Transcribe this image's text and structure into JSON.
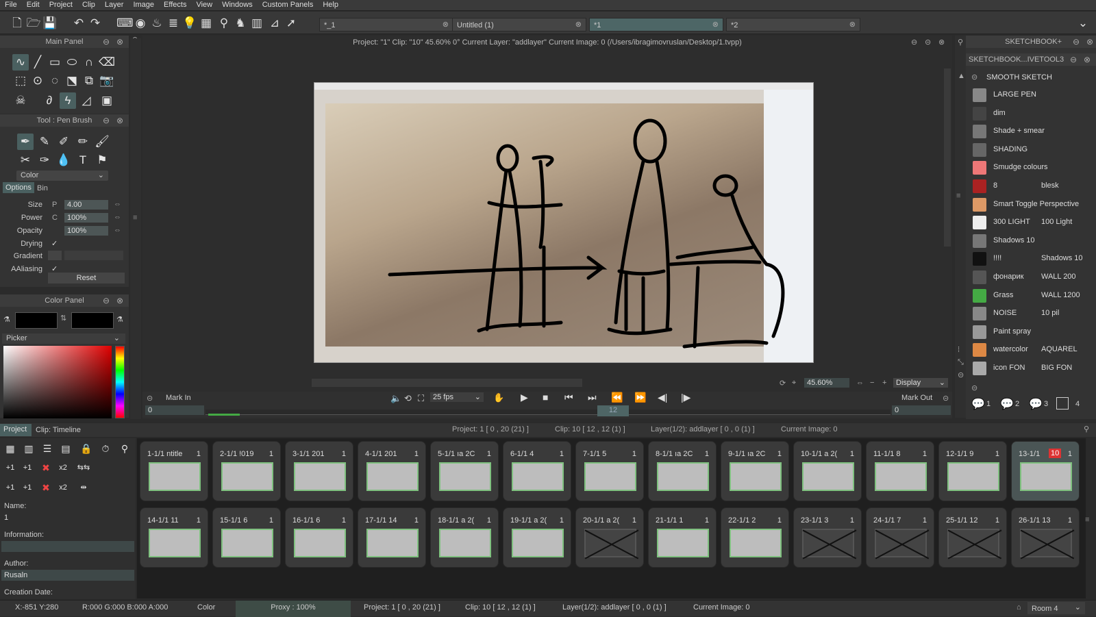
{
  "menu": [
    "File",
    "Edit",
    "Project",
    "Clip",
    "Layer",
    "Image",
    "Effects",
    "View",
    "Windows",
    "Custom Panels",
    "Help"
  ],
  "doc_tabs": [
    {
      "label": "*_1",
      "active": false
    },
    {
      "label": "Untitled (1)",
      "active": false
    },
    {
      "label": "*1",
      "active": true
    },
    {
      "label": "*2",
      "active": false
    }
  ],
  "main_panel": {
    "title": "Main Panel"
  },
  "tool_panel": {
    "title": "Tool : Pen Brush",
    "color_select": "Color",
    "tabs": [
      "Options",
      "Bin"
    ]
  },
  "props": {
    "size_label": "Size",
    "size_mode": "P",
    "size_value": "4.00",
    "power_label": "Power",
    "power_mode": "C",
    "power_value": "100%",
    "opacity_label": "Opacity",
    "opacity_value": "100%",
    "drying_label": "Drying",
    "drying_check": "✓",
    "gradient_label": "Gradient",
    "aaliasing_label": "AAliasing",
    "aaliasing_check": "✓",
    "reset_label": "Reset"
  },
  "color_panel": {
    "title": "Color Panel",
    "picker_label": "Picker"
  },
  "canvas": {
    "info": "Project: \"1\"  Clip: \"10\"   45.60%   0°  Current Layer: \"addlayer\"  Current Image: 0 (/Users/ibragimovruslan/Desktop/1.tvpp)",
    "zoom": "45.60%",
    "display": "Display",
    "fps": "25 fps",
    "mark_in": "Mark In",
    "mark_out": "Mark Out",
    "frame_start": "0",
    "frame_end": "0",
    "frame_marker": "12"
  },
  "sketchbook": {
    "title": "SKETCHBOOK+",
    "subtitle": "SKETCHBOOK...IVETOOL3",
    "section": "SMOOTH SKETCH",
    "rows": [
      {
        "labels": [
          "LARGE PEN"
        ]
      },
      {
        "labels": [
          "dim"
        ]
      },
      {
        "labels": [
          "Shade + smear"
        ]
      },
      {
        "labels": [
          "SHADING"
        ]
      },
      {
        "labels": [
          "Smudge colours"
        ]
      },
      {
        "labels": [
          "8",
          "blesk"
        ]
      },
      {
        "labels": [
          "Smart Toggle Perspective"
        ]
      },
      {
        "labels": [
          "300 LIGHT",
          "100 Light"
        ]
      },
      {
        "labels": [
          "Shadows 10"
        ]
      },
      {
        "labels": [
          "!!!!",
          "Shadows 10"
        ]
      },
      {
        "labels": [
          "фонарик",
          "WALL 200"
        ]
      },
      {
        "labels": [
          "Grass",
          "WALL 1200"
        ]
      },
      {
        "labels": [
          "NOISE",
          "10 pil"
        ]
      },
      {
        "labels": [
          "Paint spray"
        ]
      },
      {
        "labels": [
          "watercolor",
          "AQUAREL"
        ]
      },
      {
        "labels": [
          "icon FON",
          "BIG FON"
        ]
      }
    ],
    "bottom_nums": [
      "1",
      "2",
      "3",
      "4"
    ]
  },
  "project_panel": {
    "tabs": [
      "Project",
      "Clip: Timeline"
    ],
    "status": [
      "Project: 1 [ 0 , 20  (21) ]",
      "Clip: 10 [ 12 , 12  (1) ]",
      "Layer(1/2): addlayer [ 0 , 0  (1) ]",
      "Current Image: 0"
    ],
    "name_label": "Name:",
    "name_value": "1",
    "info_label": "Information:",
    "author_label": "Author:",
    "author_value": "Rusaln",
    "created_label": "Creation Date:"
  },
  "thumbs": [
    {
      "label": "1-1/1  ntitle",
      "num": "1",
      "crossed": false
    },
    {
      "label": "2-1/1  !019",
      "num": "1",
      "crossed": false
    },
    {
      "label": "3-1/1  201",
      "num": "1",
      "crossed": false
    },
    {
      "label": "4-1/1  201",
      "num": "1",
      "crossed": false
    },
    {
      "label": "5-1/1  ıa 2C",
      "num": "1",
      "crossed": false
    },
    {
      "label": "6-1/1   4",
      "num": "1",
      "crossed": false
    },
    {
      "label": "7-1/1   5",
      "num": "1",
      "crossed": false
    },
    {
      "label": "8-1/1  ıa 2C",
      "num": "1",
      "crossed": false
    },
    {
      "label": "9-1/1  ıa 2C",
      "num": "1",
      "crossed": false
    },
    {
      "label": "10-1/1  a 2(",
      "num": "1",
      "crossed": false
    },
    {
      "label": "11-1/1   8",
      "num": "1",
      "crossed": false
    },
    {
      "label": "12-1/1   9",
      "num": "1",
      "crossed": false
    },
    {
      "label": "13-1/1",
      "num": "1",
      "badge": "10",
      "crossed": false
    },
    {
      "label": "14-1/1  11",
      "num": "1",
      "crossed": false
    },
    {
      "label": "15-1/1   6",
      "num": "1",
      "crossed": false
    },
    {
      "label": "16-1/1   6",
      "num": "1",
      "crossed": false
    },
    {
      "label": "17-1/1  14",
      "num": "1",
      "crossed": false
    },
    {
      "label": "18-1/1  a 2(",
      "num": "1",
      "crossed": false
    },
    {
      "label": "19-1/1  a 2(",
      "num": "1",
      "crossed": false
    },
    {
      "label": "20-1/1  a 2(",
      "num": "1",
      "crossed": true
    },
    {
      "label": "21-1/1   1",
      "num": "1",
      "crossed": false
    },
    {
      "label": "22-1/1   2",
      "num": "1",
      "crossed": false
    },
    {
      "label": "23-1/1   3",
      "num": "1",
      "crossed": true
    },
    {
      "label": "24-1/1   7",
      "num": "1",
      "crossed": true
    },
    {
      "label": "25-1/1  12",
      "num": "1",
      "crossed": true
    },
    {
      "label": "26-1/1  13",
      "num": "1",
      "crossed": true
    }
  ],
  "statusbar": {
    "coords": "X:-851  Y:280",
    "rgba": "R:000 G:000 B:000 A:000",
    "color": "Color",
    "proxy": "Proxy : 100%",
    "project": "Project: 1 [ 0 , 20  (21) ]",
    "clip": "Clip: 10 [ 12 , 12  (1) ]",
    "layer": "Layer(1/2): addlayer [ 0 , 0  (1) ]",
    "image": "Current Image: 0",
    "room": "Room 4"
  }
}
